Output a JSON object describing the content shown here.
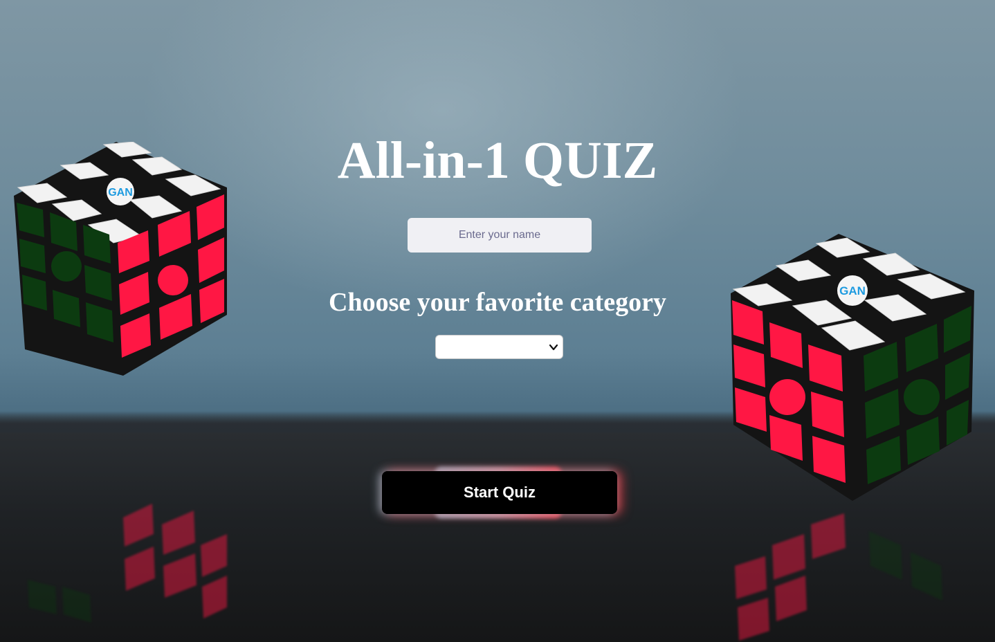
{
  "page": {
    "title": "All-in-1 QUIZ"
  },
  "form": {
    "name_placeholder": "Enter your name",
    "name_value": "",
    "category_heading": "Choose your favorite category",
    "category_selected": "",
    "start_label": "Start Quiz"
  },
  "colors": {
    "button_bg": "#000000",
    "button_text": "#ffffff",
    "heading_text": "#ffffff",
    "input_bg": "#f0f0f4",
    "placeholder": "#6a6a8e",
    "glow_left": "#8fb6c9",
    "glow_right": "#ff3d4d"
  },
  "background": {
    "description_icon": "rubiks-cube-icon"
  }
}
